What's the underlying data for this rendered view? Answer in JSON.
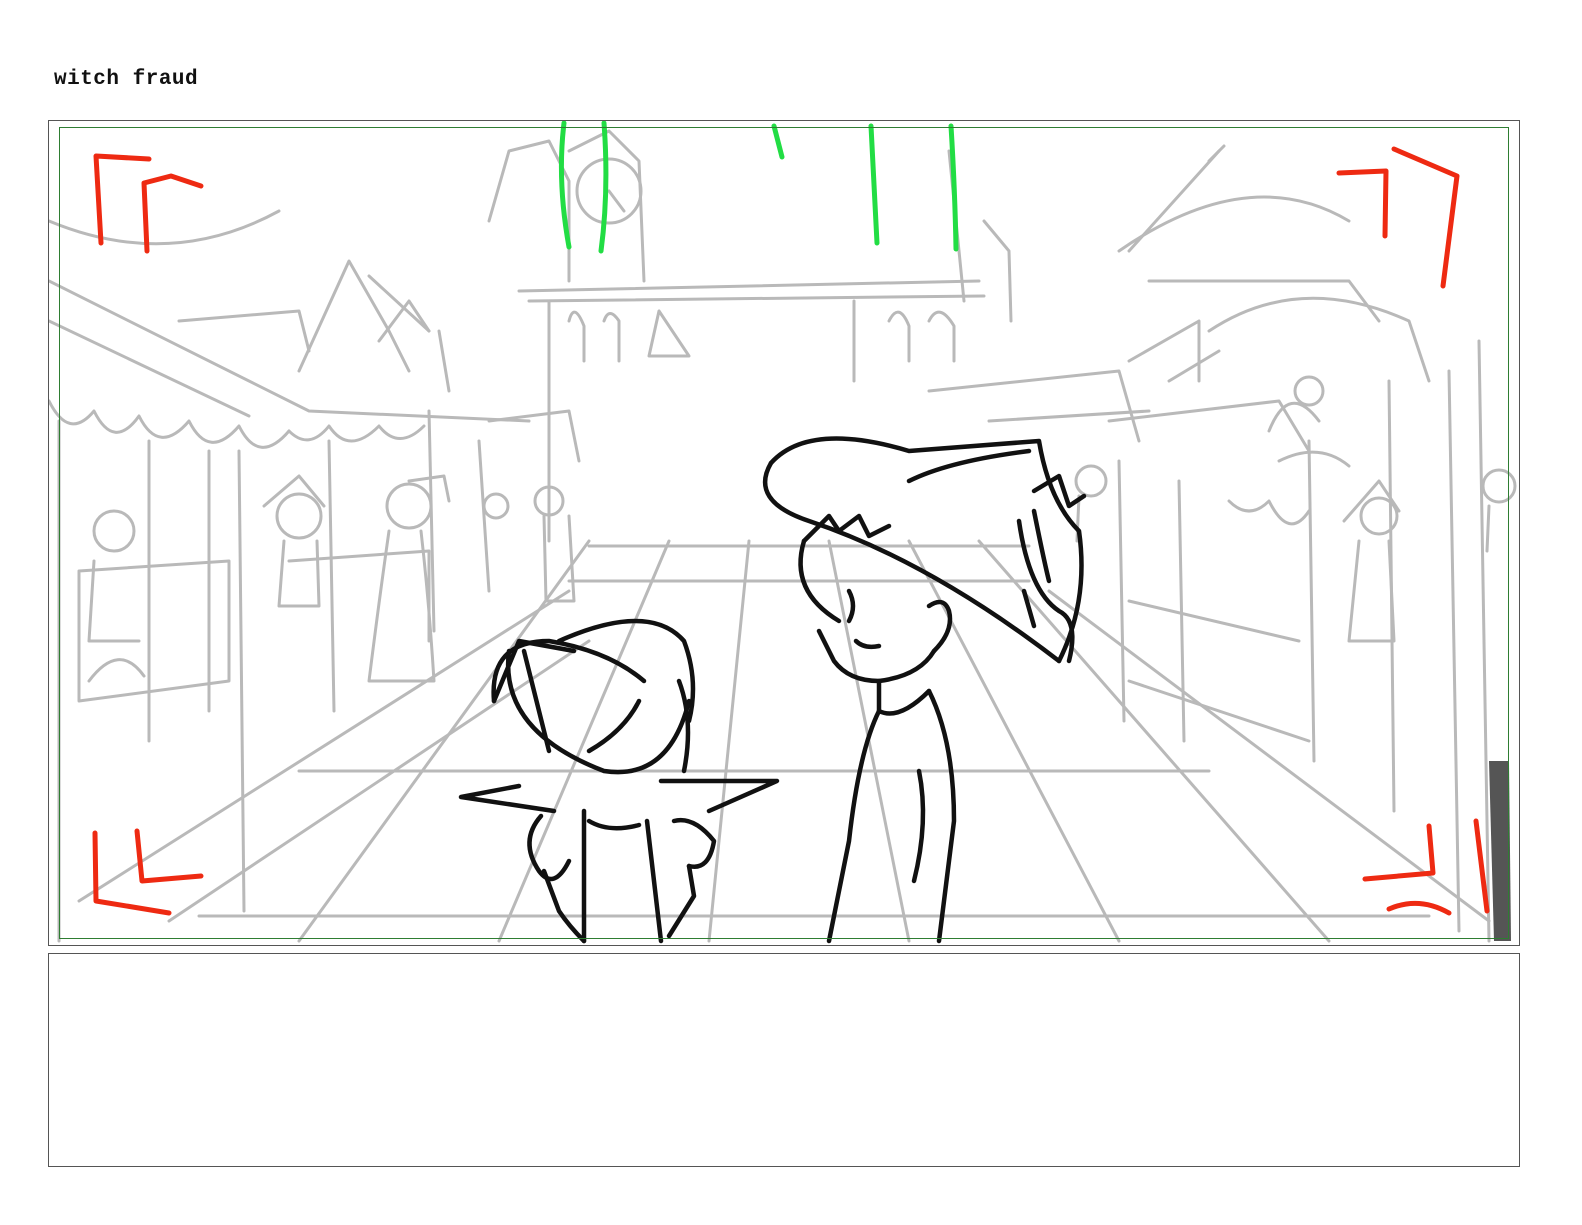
{
  "scene": {
    "title": "witch fraud"
  },
  "panel": {
    "notes": ""
  },
  "colors": {
    "rough_background": "#b9b9b9",
    "character_line": "#111111",
    "camera_marks": "#ee2a12",
    "light_rays": "#22dd44",
    "safe_area": "#2e7d32"
  }
}
